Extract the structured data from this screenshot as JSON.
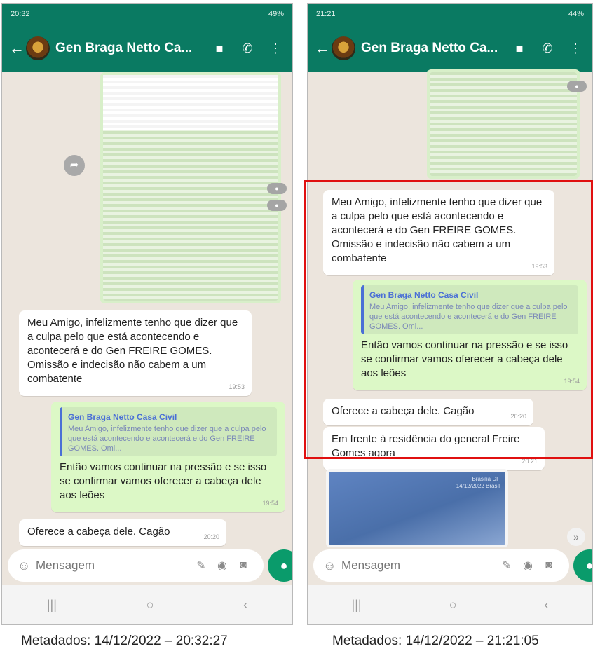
{
  "colors": {
    "header": "#0a7a62",
    "bubble_in": "#ffffff",
    "bubble_out": "#dcf8c6",
    "highlight": "#e01010",
    "quote_accent": "#4a6fd6"
  },
  "left": {
    "status_time": "20:32",
    "status_right": "49%",
    "contact": "Gen Braga Netto Ca...",
    "messages": {
      "m1": {
        "text": "Meu Amigo, infelizmente tenho que dizer que a culpa pelo que está acontecendo e acontecerá e do Gen FREIRE GOMES. Omissão e indecisão não cabem a um combatente",
        "time": "19:53"
      },
      "m2": {
        "quote_name": "Gen Braga Netto Casa Civil",
        "quote_text": "Meu Amigo, infelizmente tenho que dizer que a culpa pelo que está acontecendo e acontecerá e do Gen FREIRE GOMES. Omi...",
        "text": "Então vamos continuar na pressão e se isso se confirmar vamos oferecer a cabeça dele aos leões",
        "time": "19:54"
      },
      "m3": {
        "text": "Oferece a cabeça dele. Cagão",
        "time": "20:20"
      }
    },
    "placeholder": "Mensagem",
    "caption": "Metadados: 14/12/2022 – 20:32:27"
  },
  "right": {
    "status_time": "21:21",
    "status_right": "44%",
    "contact": "Gen Braga Netto Ca...",
    "messages": {
      "m1": {
        "text": "Meu Amigo, infelizmente tenho que dizer que a culpa pelo que está acontecendo e acontecerá e do Gen FREIRE GOMES. Omissão e indecisão não cabem a um combatente",
        "time": "19:53"
      },
      "m2": {
        "quote_name": "Gen Braga Netto Casa Civil",
        "quote_text": "Meu Amigo, infelizmente tenho que dizer que a culpa pelo que está acontecendo e acontecerá e do Gen FREIRE GOMES. Omi...",
        "text": "Então vamos continuar na pressão e se isso se confirmar vamos oferecer a cabeça dele aos leões",
        "time": "19:54"
      },
      "m3": {
        "text": "Oferece a cabeça dele. Cagão",
        "time": "20:20"
      },
      "m4": {
        "text": "Em frente à residência do general Freire Gomes agora",
        "time": "20:21"
      }
    },
    "thumb_caption": "Brasília DF 14/12/2022 Brasil",
    "placeholder": "Mensagem",
    "caption": "Metadados: 14/12/2022 – 21:21:05"
  },
  "icons": {
    "back": "arrow-left-icon",
    "video": "video-camera-icon",
    "call": "phone-icon",
    "menu": "more-vertical-icon",
    "emoji": "emoji-icon",
    "attach": "paperclip-icon",
    "payment": "payment-icon",
    "camera": "camera-icon",
    "mic": "microphone-icon",
    "share": "forward-icon"
  }
}
